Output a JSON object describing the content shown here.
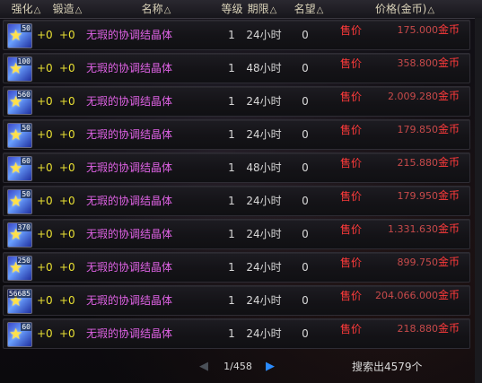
{
  "header": {
    "columns": [
      {
        "label": "强化",
        "sort": "△"
      },
      {
        "label": "锻造",
        "sort": "△"
      },
      {
        "label": "名称",
        "sort": "△"
      },
      {
        "label": "等级",
        "sort": ""
      },
      {
        "label": "期限",
        "sort": "△"
      },
      {
        "label": "名望",
        "sort": "△"
      },
      {
        "label": "价格(金币)",
        "sort": "△"
      }
    ]
  },
  "item_icon": "coordination-crystal-icon",
  "colors": {
    "item_name": "#e063e6",
    "enhance": "#e9e033",
    "price": "#ff3a3a",
    "next_arrow": "#2b8cff"
  },
  "rows": [
    {
      "qty": "50",
      "enhance": "+0",
      "forge": "+0",
      "name": "无瑕的协调结晶体",
      "level": "1",
      "period": "24小时",
      "fame": "0",
      "sell": "售价",
      "price": "175.000",
      "unit": "金币"
    },
    {
      "qty": "100",
      "enhance": "+0",
      "forge": "+0",
      "name": "无瑕的协调结晶体",
      "level": "1",
      "period": "48小时",
      "fame": "0",
      "sell": "售价",
      "price": "358.800",
      "unit": "金币"
    },
    {
      "qty": "560",
      "enhance": "+0",
      "forge": "+0",
      "name": "无瑕的协调结晶体",
      "level": "1",
      "period": "24小时",
      "fame": "0",
      "sell": "售价",
      "price": "2.009.280",
      "unit": "金币"
    },
    {
      "qty": "50",
      "enhance": "+0",
      "forge": "+0",
      "name": "无瑕的协调结晶体",
      "level": "1",
      "period": "24小时",
      "fame": "0",
      "sell": "售价",
      "price": "179.850",
      "unit": "金币"
    },
    {
      "qty": "60",
      "enhance": "+0",
      "forge": "+0",
      "name": "无瑕的协调结晶体",
      "level": "1",
      "period": "48小时",
      "fame": "0",
      "sell": "售价",
      "price": "215.880",
      "unit": "金币"
    },
    {
      "qty": "50",
      "enhance": "+0",
      "forge": "+0",
      "name": "无瑕的协调结晶体",
      "level": "1",
      "period": "24小时",
      "fame": "0",
      "sell": "售价",
      "price": "179.950",
      "unit": "金币"
    },
    {
      "qty": "370",
      "enhance": "+0",
      "forge": "+0",
      "name": "无瑕的协调结晶体",
      "level": "1",
      "period": "24小时",
      "fame": "0",
      "sell": "售价",
      "price": "1.331.630",
      "unit": "金币"
    },
    {
      "qty": "250",
      "enhance": "+0",
      "forge": "+0",
      "name": "无瑕的协调结晶体",
      "level": "1",
      "period": "24小时",
      "fame": "0",
      "sell": "售价",
      "price": "899.750",
      "unit": "金币"
    },
    {
      "qty": "56685",
      "enhance": "+0",
      "forge": "+0",
      "name": "无瑕的协调结晶体",
      "level": "1",
      "period": "24小时",
      "fame": "0",
      "sell": "售价",
      "price": "204.066.000",
      "unit": "金币"
    },
    {
      "qty": "60",
      "enhance": "+0",
      "forge": "+0",
      "name": "无瑕的协调结晶体",
      "level": "1",
      "period": "24小时",
      "fame": "0",
      "sell": "售价",
      "price": "218.880",
      "unit": "金币"
    }
  ],
  "pager": {
    "prev_icon": "prev-arrow-icon",
    "next_icon": "next-arrow-icon",
    "page_info": "1/458"
  },
  "search_count": "搜索出4579个"
}
